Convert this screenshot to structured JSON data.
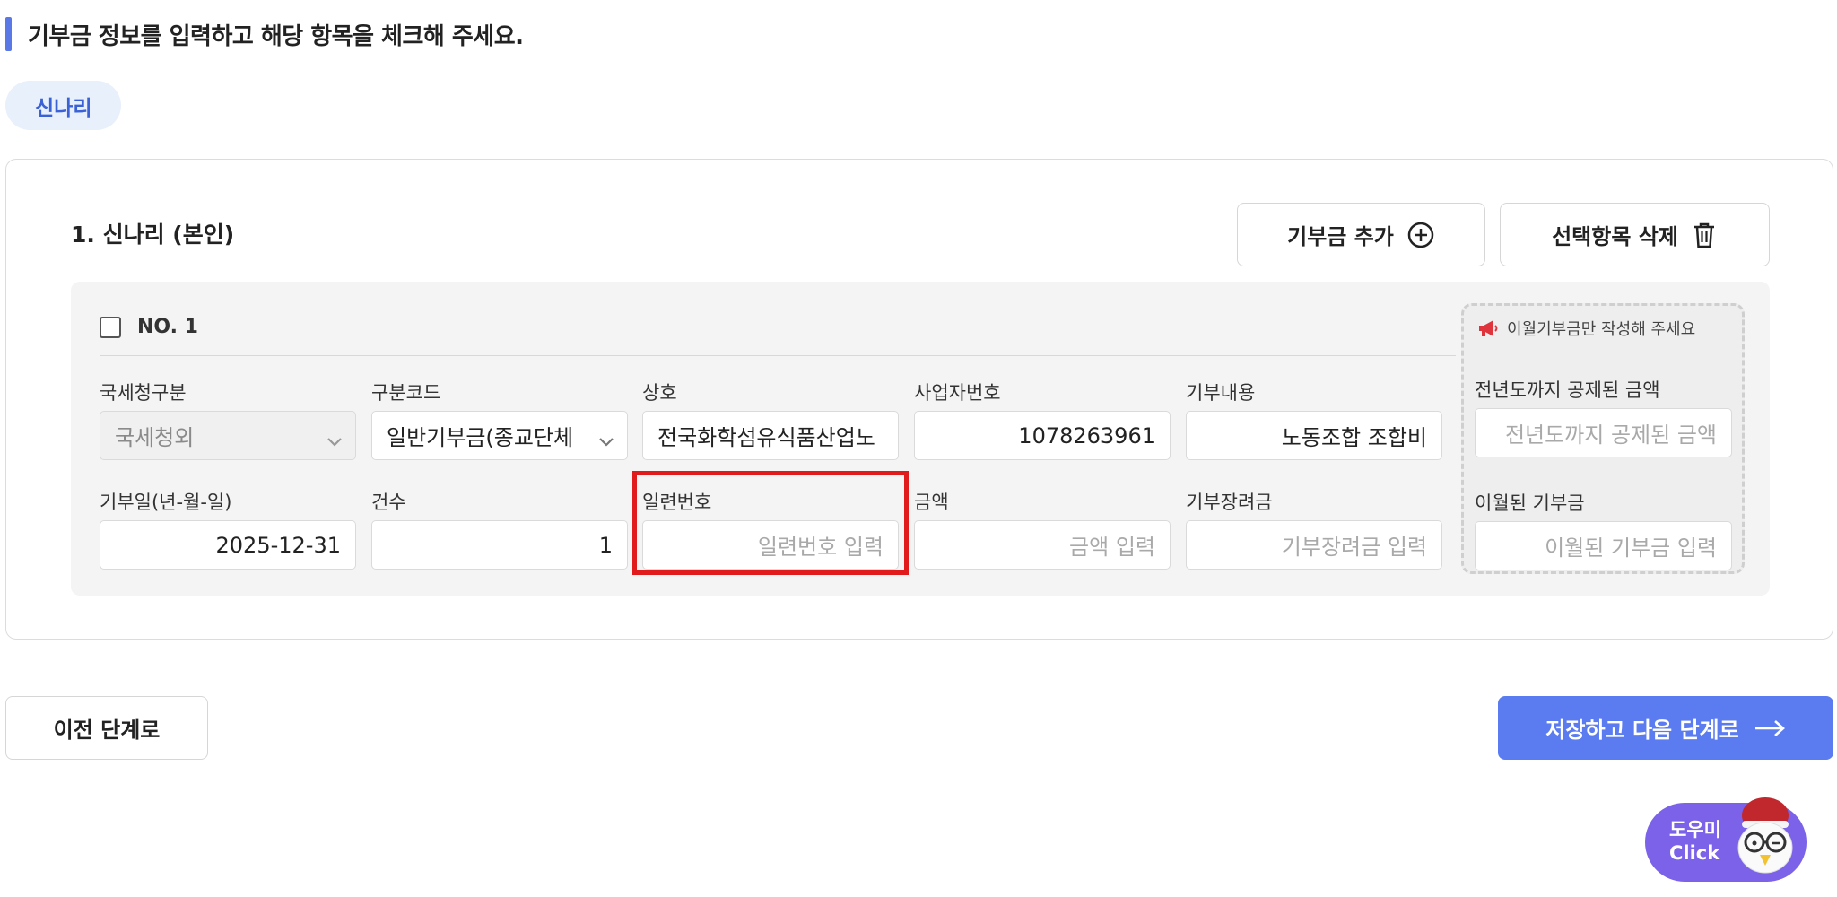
{
  "header": {
    "title": "기부금 정보를 입력하고 해당 항목을 체크해 주세요."
  },
  "person_tab": {
    "label": "신나리"
  },
  "section": {
    "title": "1. 신나리 (본인)",
    "add_button": "기부금 추가",
    "delete_button": "선택항목 삭제"
  },
  "entry": {
    "number_label": "NO. 1",
    "fields": {
      "tax_type": {
        "label": "국세청구분",
        "value": "국세청외"
      },
      "category_code": {
        "label": "구분코드",
        "value": "일반기부금(종교단체"
      },
      "company_name": {
        "label": "상호",
        "value": "전국화학섬유식품산업노"
      },
      "business_number": {
        "label": "사업자번호",
        "value": "1078263961"
      },
      "donation_content": {
        "label": "기부내용",
        "value": "노동조합 조합비"
      },
      "donation_date": {
        "label": "기부일(년-월-일)",
        "value": "2025-12-31"
      },
      "count": {
        "label": "건수",
        "value": "1"
      },
      "serial_number": {
        "label": "일련번호",
        "placeholder": "일련번호 입력"
      },
      "amount": {
        "label": "금액",
        "placeholder": "금액 입력"
      },
      "incentive": {
        "label": "기부장려금",
        "placeholder": "기부장려금 입력"
      }
    },
    "carryover": {
      "notice": "이월기부금만 작성해 주세요",
      "deducted_label": "전년도까지 공제된 금액",
      "deducted_placeholder": "전년도까지 공제된 금액",
      "carried_label": "이월된 기부금",
      "carried_placeholder": "이월된 기부금 입력"
    }
  },
  "footer": {
    "prev_button": "이전 단계로",
    "next_button": "저장하고 다음 단계로"
  },
  "helper": {
    "line1": "도우미",
    "line2": "Click"
  },
  "colors": {
    "accent": "#5a78e6",
    "primary_button": "#5b7cf0",
    "highlight_border": "#e11b1b",
    "helper_bg": "#7b62e8",
    "chip_bg": "#e8f0fc"
  },
  "icons": {
    "add": "plus-circle-icon",
    "delete": "trash-icon",
    "next": "arrow-right-icon",
    "notice": "megaphone-icon",
    "select": "chevron-down-icon"
  }
}
